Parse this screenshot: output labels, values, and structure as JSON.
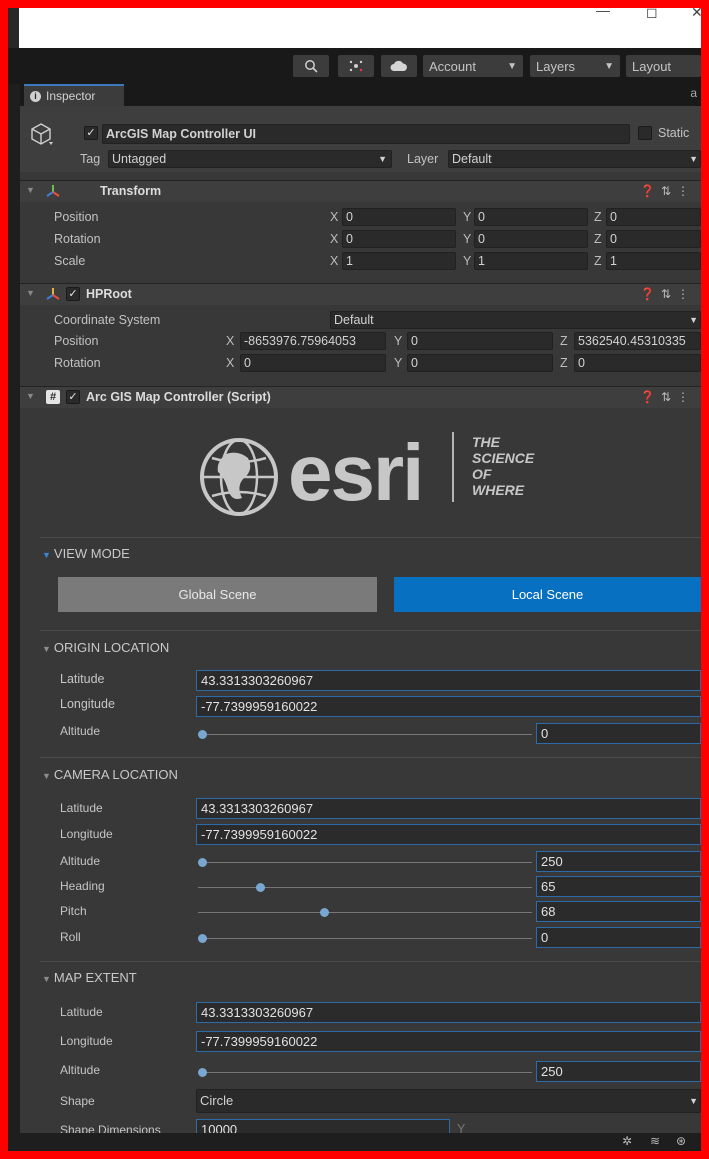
{
  "toolbar": {
    "account_label": "Account",
    "layers_label": "Layers",
    "layout_label": "Layout"
  },
  "inspector": {
    "tab_label": "Inspector",
    "object_name": "ArcGIS Map Controller UI",
    "static_label": "Static",
    "tag_label": "Tag",
    "tag_value": "Untagged",
    "layer_label": "Layer",
    "layer_value": "Default"
  },
  "transform": {
    "title": "Transform",
    "position_label": "Position",
    "rotation_label": "Rotation",
    "scale_label": "Scale",
    "position": {
      "x": "0",
      "y": "0",
      "z": "0"
    },
    "rotation": {
      "x": "0",
      "y": "0",
      "z": "0"
    },
    "scale": {
      "x": "1",
      "y": "1",
      "z": "1"
    }
  },
  "axes": {
    "x": "X",
    "y": "Y",
    "z": "Z"
  },
  "hproot": {
    "title": "HPRoot",
    "coord_label": "Coordinate System",
    "coord_value": "Default",
    "position_label": "Position",
    "rotation_label": "Rotation",
    "position": {
      "x": "-8653976.75964053",
      "y": "0",
      "z": "5362540.45310335"
    },
    "rotation": {
      "x": "0",
      "y": "0",
      "z": "0"
    }
  },
  "script": {
    "title": "Arc GIS Map Controller (Script)",
    "logo": {
      "word": "esri",
      "tagline": [
        "THE",
        "SCIENCE",
        "OF",
        "WHERE"
      ]
    }
  },
  "view_mode": {
    "title": "VIEW MODE",
    "global_label": "Global Scene",
    "local_label": "Local Scene",
    "active": "Local Scene"
  },
  "origin": {
    "title": "ORIGIN LOCATION",
    "latitude_label": "Latitude",
    "latitude": "43.3313303260967",
    "longitude_label": "Longitude",
    "longitude": "-77.7399959160022",
    "altitude_label": "Altitude",
    "altitude": "0"
  },
  "camera": {
    "title": "CAMERA LOCATION",
    "latitude_label": "Latitude",
    "latitude": "43.3313303260967",
    "longitude_label": "Longitude",
    "longitude": "-77.7399959160022",
    "altitude_label": "Altitude",
    "altitude": "250",
    "heading_label": "Heading",
    "heading": "65",
    "pitch_label": "Pitch",
    "pitch": "68",
    "roll_label": "Roll",
    "roll": "0"
  },
  "extent": {
    "title": "MAP EXTENT",
    "latitude_label": "Latitude",
    "latitude": "43.3313303260967",
    "longitude_label": "Longitude",
    "longitude": "-77.7399959160022",
    "altitude_label": "Altitude",
    "altitude": "250",
    "shape_label": "Shape",
    "shape": "Circle",
    "dims_label": "Shape Dimensions",
    "dims_x": "10000",
    "dims_y_label": "Y"
  },
  "colors": {
    "accent": "#0870c1",
    "field_border": "#2c6ba7",
    "panel": "#383838",
    "frame": "#ff0000"
  }
}
